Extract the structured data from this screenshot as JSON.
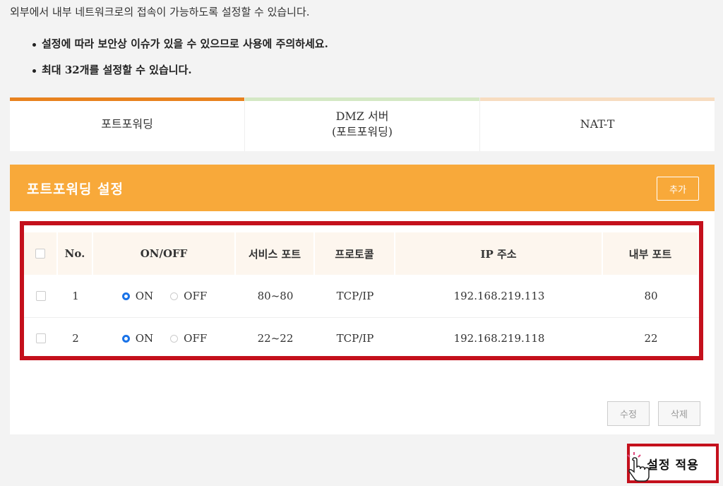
{
  "intro": "외부에서 내부 네트워크로의 접속이 가능하도록 설정할 수 있습니다.",
  "notes": [
    "설정에 따라 보안상 이슈가 있을 수 있으므로 사용에 주의하세요.",
    "최대 32개를 설정할 수 있습니다."
  ],
  "tabs": [
    {
      "label": "포트포워딩"
    },
    {
      "label_line1": "DMZ 서버",
      "label_line2": "(포트포워딩)"
    },
    {
      "label": "NAT-T"
    }
  ],
  "section": {
    "title": "포트포워딩 설정",
    "add_label": "추가"
  },
  "table": {
    "headers": [
      "No.",
      "ON/OFF",
      "서비스 포트",
      "프로토콜",
      "IP 주소",
      "내부 포트"
    ],
    "on_label": "ON",
    "off_label": "OFF",
    "rows": [
      {
        "no": "1",
        "state": "ON",
        "service_port": "80~80",
        "protocol": "TCP/IP",
        "ip": "192.168.219.113",
        "internal_port": "80"
      },
      {
        "no": "2",
        "state": "ON",
        "service_port": "22~22",
        "protocol": "TCP/IP",
        "ip": "192.168.219.118",
        "internal_port": "22"
      }
    ]
  },
  "actions": {
    "edit_label": "수정",
    "delete_label": "삭제",
    "apply_label": "설정 적용"
  },
  "colors": {
    "accent": "#f8a93a",
    "highlight": "#c4101c",
    "radio_on": "#1a73e8"
  }
}
